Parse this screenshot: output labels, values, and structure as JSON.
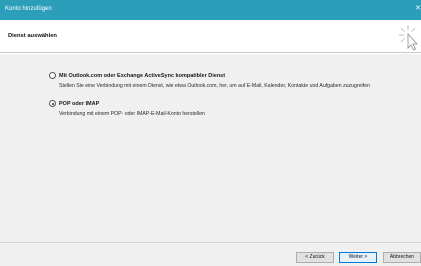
{
  "window": {
    "title": "Konto hinzufügen",
    "close_label": "✕"
  },
  "header": {
    "heading": "Dienst auswählen",
    "wizard_icon": "cursor-sparkle-icon"
  },
  "options": [
    {
      "label": "Mit Outlook.com oder Exchange ActiveSync kompatibler Dienst",
      "description": "Stellen Sie eine Verbindung mit einem Dienst, wie etwa Outlook.com, her, um auf E-Mail, Kalender, Kontakte und Aufgaben zuzugreifen",
      "selected": false
    },
    {
      "label": "POP oder IMAP",
      "description": "Verbindung mit einem POP- oder IMAP-E-Mail-Konto herstellen",
      "selected": true
    }
  ],
  "buttons": {
    "back": "< Zurück",
    "next": "Weiter >",
    "cancel": "Abbrechen"
  },
  "colors": {
    "titlebar": "#2b9fb9",
    "focus_border": "#0078d7"
  }
}
